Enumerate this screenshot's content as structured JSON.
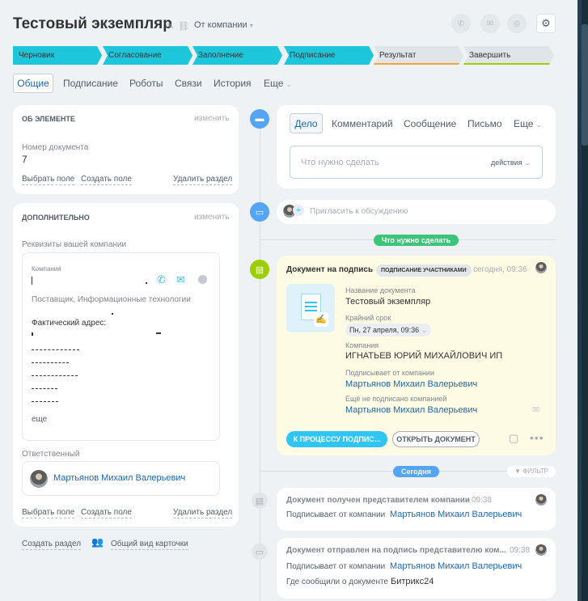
{
  "header": {
    "title": "Тестовый экземпляр",
    "from_label": "От компании"
  },
  "stages": [
    "Черновик",
    "Согласование",
    "Заполнение",
    "Подписание",
    "Результат",
    "Завершить"
  ],
  "tabs": [
    "Общие",
    "Подписание",
    "Роботы",
    "Связи",
    "История",
    "Еще"
  ],
  "about": {
    "title": "ОБ ЭЛЕМЕНТЕ",
    "edit": "изменить",
    "doc_number_label": "Номер документа",
    "doc_number": "7",
    "select_field": "Выбрать поле",
    "create_field": "Создать поле",
    "delete_section": "Удалить раздел"
  },
  "extra": {
    "title": "ДОПОЛНИТЕЛЬНО",
    "edit": "изменить",
    "requisites_label": "Реквизиты вашей компании",
    "company_label": "Компания",
    "company_desc": "Поставщик, Информационные технологии",
    "address_label": "Фактический адрес:",
    "more": "еще",
    "responsible_label": "Ответственный",
    "responsible_name": "Мартьянов Михаил Валерьевич",
    "select_field": "Выбрать поле",
    "create_field": "Создать поле",
    "delete_section": "Удалить раздел"
  },
  "bottom_links": {
    "create_section": "Создать раздел",
    "general_view": "Общий вид карточки"
  },
  "composer": {
    "tabs": [
      "Дело",
      "Комментарий",
      "Сообщение",
      "Письмо",
      "Еще"
    ],
    "placeholder": "Что нужно сделать",
    "actions": "действия"
  },
  "invite_placeholder": "Пригласить к обсуждению",
  "todo_badge": "Что нужно сделать",
  "doc_card": {
    "title": "Документ на подпись",
    "badge": "ПОДПИСАНИЕ УЧАСТНИКАМИ",
    "time": "сегодня, 09:36",
    "name_label": "Название документа",
    "name_value": "Тестовый экземпляр",
    "deadline_label": "Крайний срок",
    "deadline_value": "Пн, 27 апреля, 09:36",
    "company_label": "Компания",
    "company_value": "ИГНАТЬЕВ ЮРИЙ МИХАЙЛОВИЧ ИП",
    "signer_label": "Подписывает от компании",
    "signer_value": "Мартьянов Михаил Валерьевич",
    "unsigned_label": "Ещё не подписано компанией",
    "unsigned_value": "Мартьянов Михаил Валерьевич",
    "btn_process": "К ПРОЦЕССУ ПОДПИС...",
    "btn_open": "ОТКРЫТЬ ДОКУМЕНТ"
  },
  "today_badge": "Сегодня",
  "filter_label": "ФИЛЬТР",
  "history": [
    {
      "title": "Документ получен представителем компании",
      "time": "09:38",
      "rows": [
        {
          "label": "Подписывает от компании",
          "value": "Мартьянов Михаил Валерьевич"
        }
      ]
    },
    {
      "title": "Документ отправлен на подпись представителю ком...",
      "time": "09:38",
      "rows": [
        {
          "label": "Подписывает от компании",
          "value": "Мартьянов Михаил Валерьевич"
        },
        {
          "label": "Где сообщили о документе",
          "value": "Битрикс24"
        }
      ]
    }
  ],
  "colors": {
    "stage_active": "#1ec6dc",
    "stage_inactive": "#dfe5e8",
    "accent_blue": "#2fc6f6",
    "green": "#9dcf00",
    "timeline_blue": "#55a5f5"
  }
}
